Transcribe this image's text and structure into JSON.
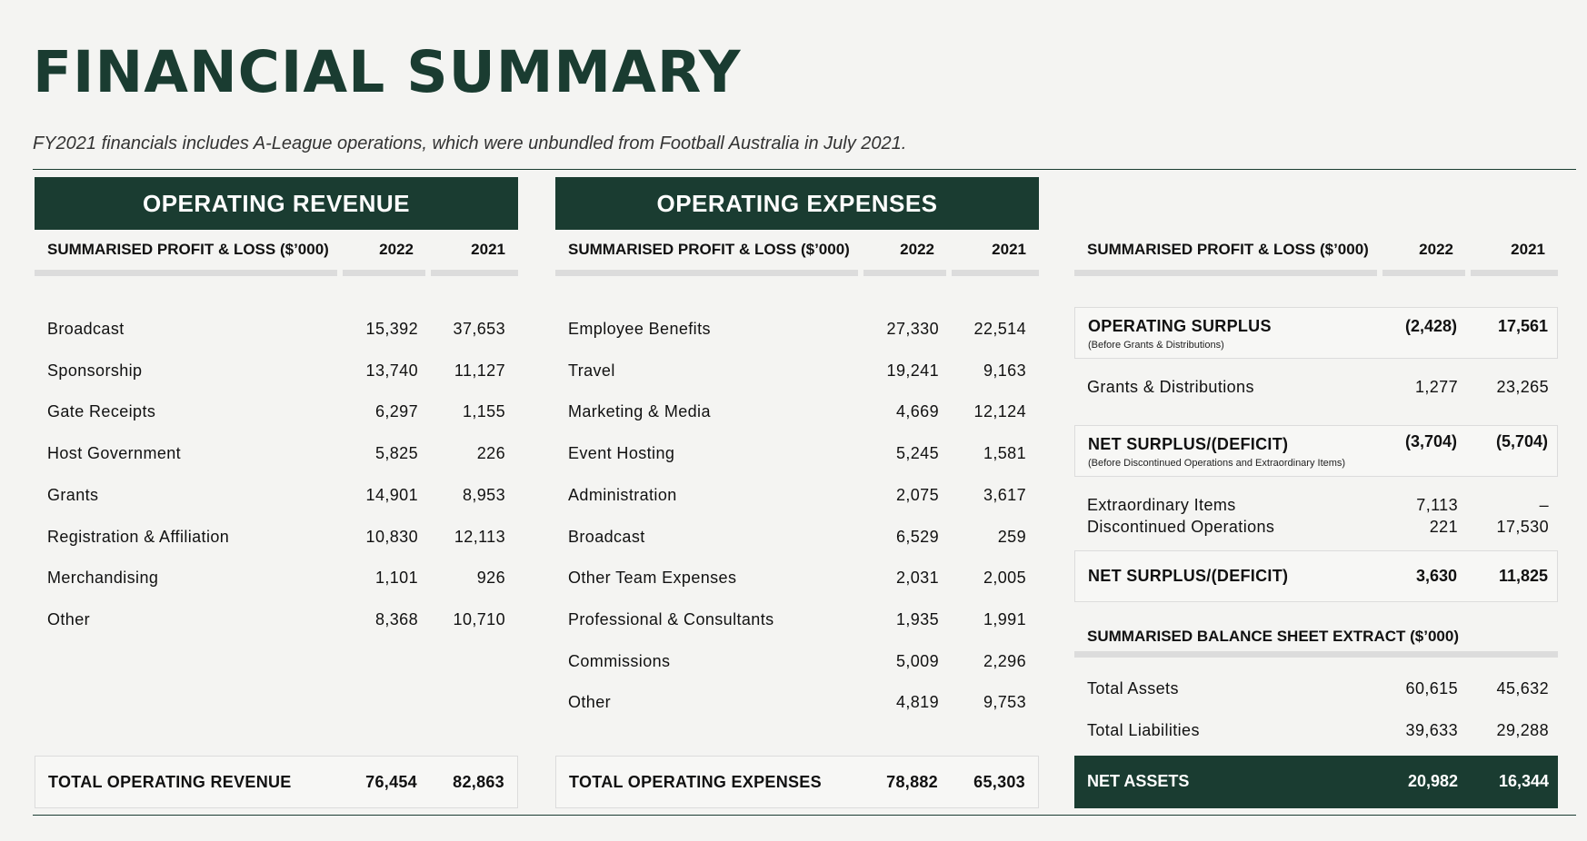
{
  "title": "FINANCIAL SUMMARY",
  "subtitle": "FY2021 financials includes A-League operations, which were unbundled from Football Australia in July 2021.",
  "revenue": {
    "banner": "OPERATING REVENUE",
    "header": {
      "label": "SUMMARISED PROFIT & LOSS ($’000)",
      "y2022": "2022",
      "y2021": "2021"
    },
    "rows": [
      {
        "label": "Broadcast",
        "v2022": "15,392",
        "v2021": "37,653"
      },
      {
        "label": "Sponsorship",
        "v2022": "13,740",
        "v2021": "11,127"
      },
      {
        "label": "Gate Receipts",
        "v2022": "6,297",
        "v2021": "1,155"
      },
      {
        "label": "Host Government",
        "v2022": "5,825",
        "v2021": "226"
      },
      {
        "label": "Grants",
        "v2022": "14,901",
        "v2021": "8,953"
      },
      {
        "label": "Registration & Affiliation",
        "v2022": "10,830",
        "v2021": "12,113"
      },
      {
        "label": "Merchandising",
        "v2022": "1,101",
        "v2021": "926"
      },
      {
        "label": "Other",
        "v2022": "8,368",
        "v2021": "10,710"
      }
    ],
    "total": {
      "label": "TOTAL OPERATING REVENUE",
      "v2022": "76,454",
      "v2021": "82,863"
    }
  },
  "expenses": {
    "banner": "OPERATING EXPENSES",
    "header": {
      "label": "SUMMARISED PROFIT & LOSS ($’000)",
      "y2022": "2022",
      "y2021": "2021"
    },
    "rows": [
      {
        "label": "Employee Benefits",
        "v2022": "27,330",
        "v2021": "22,514"
      },
      {
        "label": "Travel",
        "v2022": "19,241",
        "v2021": "9,163"
      },
      {
        "label": "Marketing & Media",
        "v2022": "4,669",
        "v2021": "12,124"
      },
      {
        "label": "Event Hosting",
        "v2022": "5,245",
        "v2021": "1,581"
      },
      {
        "label": "Administration",
        "v2022": "2,075",
        "v2021": "3,617"
      },
      {
        "label": "Broadcast",
        "v2022": "6,529",
        "v2021": "259"
      },
      {
        "label": "Other Team Expenses",
        "v2022": "2,031",
        "v2021": "2,005"
      },
      {
        "label": "Professional & Consultants",
        "v2022": "1,935",
        "v2021": "1,991"
      },
      {
        "label": "Commissions",
        "v2022": "5,009",
        "v2021": "2,296"
      },
      {
        "label": "Other",
        "v2022": "4,819",
        "v2021": "9,753"
      }
    ],
    "total": {
      "label": "TOTAL OPERATING EXPENSES",
      "v2022": "78,882",
      "v2021": "65,303"
    }
  },
  "summary": {
    "header": {
      "label": "SUMMARISED PROFIT & LOSS ($’000)",
      "y2022": "2022",
      "y2021": "2021"
    },
    "operating_surplus": {
      "label": "OPERATING SURPLUS",
      "note": "(Before Grants & Distributions)",
      "v2022": "(2,428)",
      "v2021": "17,561"
    },
    "grants": {
      "label": "Grants & Distributions",
      "v2022": "1,277",
      "v2021": "23,265"
    },
    "net_surplus_before": {
      "label": "NET SURPLUS/(DEFICIT)",
      "note": "(Before Discontinued Operations and Extraordinary Items)",
      "v2022": "(3,704)",
      "v2021": "(5,704)"
    },
    "extraordinary": {
      "label": "Extraordinary Items",
      "v2022": "7,113",
      "v2021": "–"
    },
    "discontinued": {
      "label": "Discontinued Operations",
      "v2022": "221",
      "v2021": "17,530"
    },
    "net_surplus": {
      "label": "NET SURPLUS/(DEFICIT)",
      "v2022": "3,630",
      "v2021": "11,825"
    },
    "balance_title": "SUMMARISED BALANCE SHEET EXTRACT ($’000)",
    "total_assets": {
      "label": "Total Assets",
      "v2022": "60,615",
      "v2021": "45,632"
    },
    "total_liabilities": {
      "label": "Total Liabilities",
      "v2022": "39,633",
      "v2021": "29,288"
    },
    "net_assets": {
      "label": "NET ASSETS",
      "v2022": "20,982",
      "v2021": "16,344"
    }
  }
}
